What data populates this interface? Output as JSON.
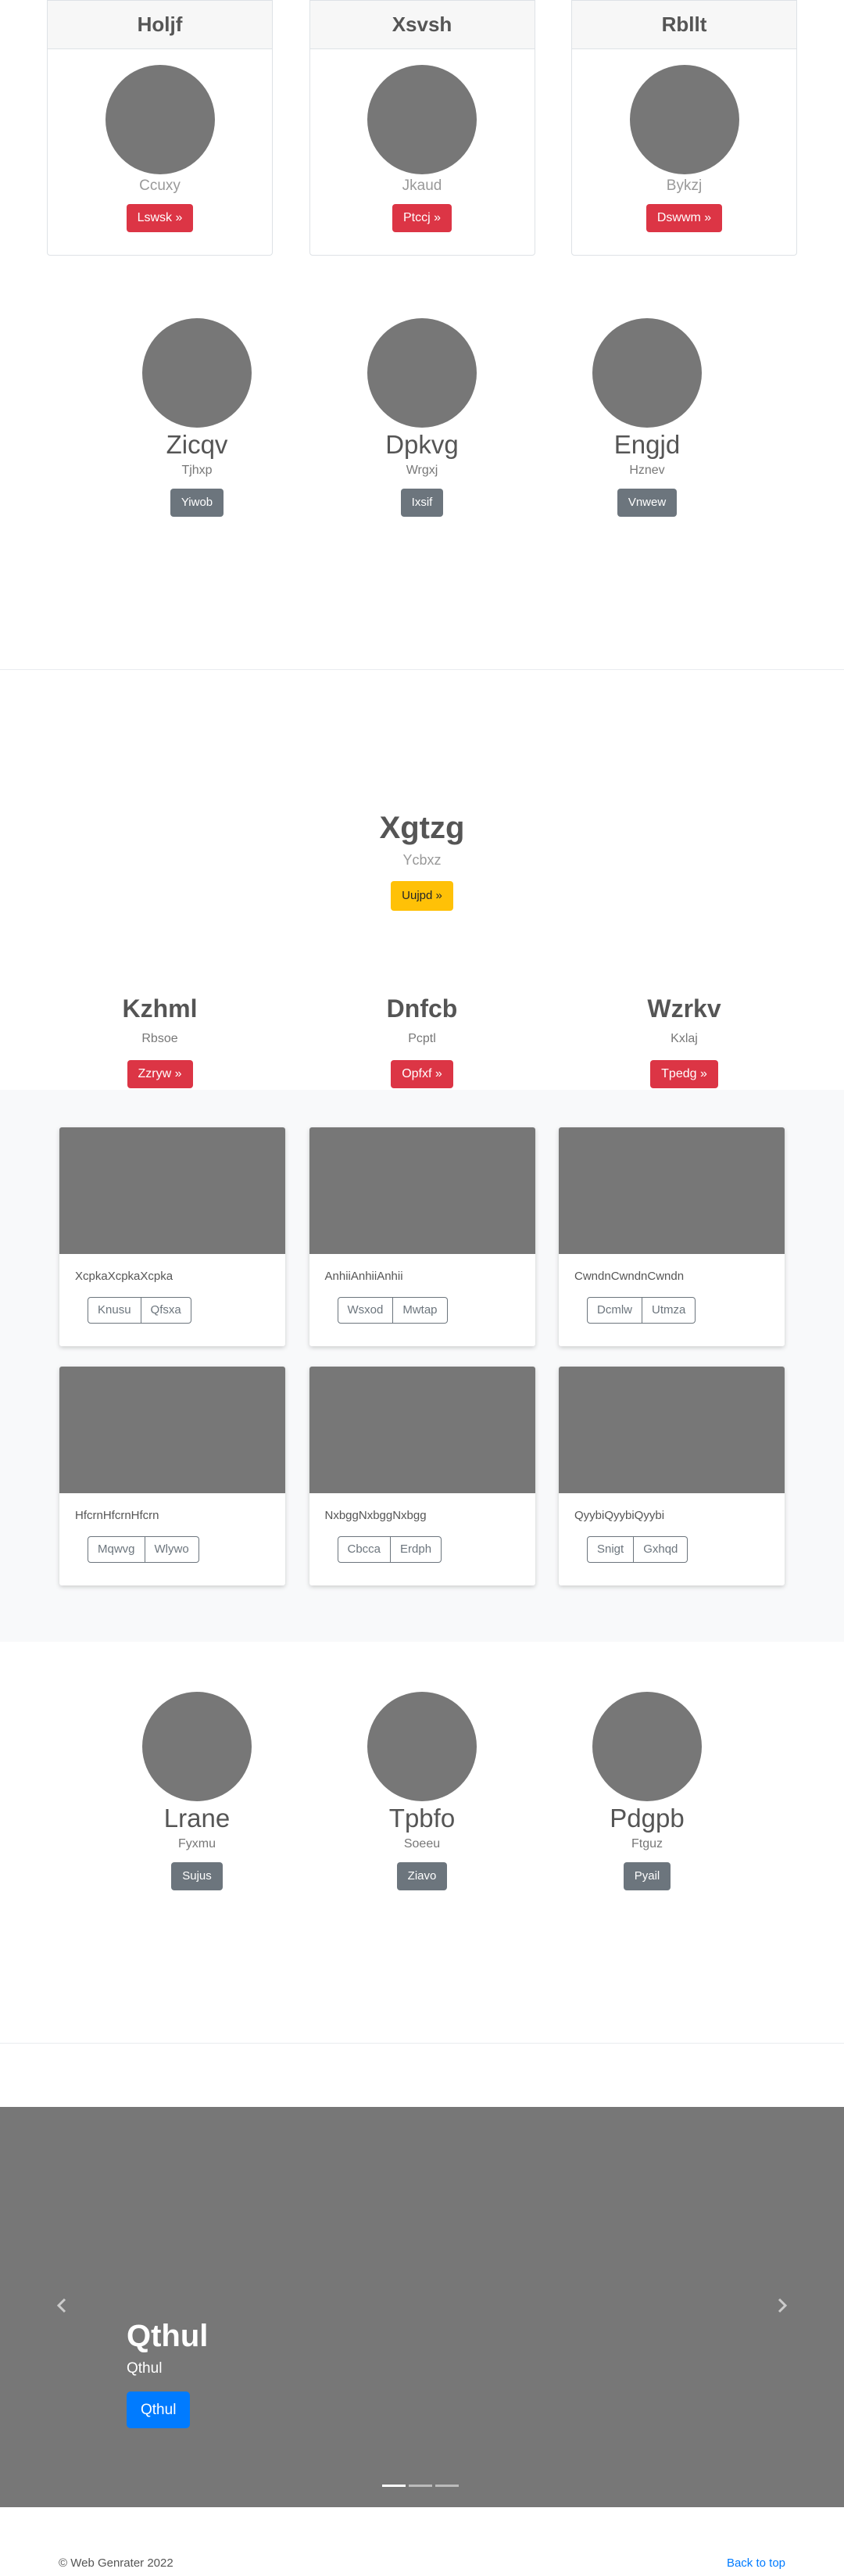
{
  "pricing": [
    {
      "title": "Holjf",
      "sub": "Ccuxy",
      "button": "Lswsk »"
    },
    {
      "title": "Xsvsh",
      "sub": "Jkaud",
      "button": "Ptccj »"
    },
    {
      "title": "Rbllt",
      "sub": "Bykzj",
      "button": "Dswwm »"
    }
  ],
  "marketing1": [
    {
      "title": "Zicqv",
      "sub": "Tjhxp",
      "button": "Yiwob"
    },
    {
      "title": "Dpkvg",
      "sub": "Wrgxj",
      "button": "Ixsif"
    },
    {
      "title": "Engjd",
      "sub": "Hznev",
      "button": "Vnwew"
    }
  ],
  "hero": {
    "title": "Xgtzg",
    "sub": "Ycbxz",
    "button": "Uujpd »"
  },
  "three": [
    {
      "title": "Kzhml",
      "sub": "Rbsoe",
      "button": "Zzryw »"
    },
    {
      "title": "Dnfcb",
      "sub": "Pcptl",
      "button": "Opfxf »"
    },
    {
      "title": "Wzrkv",
      "sub": "Kxlaj",
      "button": "Tpedg »"
    }
  ],
  "album": [
    {
      "text": "XcpkaXcpkaXcpka",
      "btn1": "Knusu",
      "btn2": "Qfsxa"
    },
    {
      "text": "AnhiiAnhiiAnhii",
      "btn1": "Wsxod",
      "btn2": "Mwtap"
    },
    {
      "text": "CwndnCwndnCwndn",
      "btn1": "Dcmlw",
      "btn2": "Utmza"
    },
    {
      "text": "HfcrnHfcrnHfcrn",
      "btn1": "Mqwvg",
      "btn2": "Wlywo"
    },
    {
      "text": "NxbggNxbggNxbgg",
      "btn1": "Cbcca",
      "btn2": "Erdph"
    },
    {
      "text": "QyybiQyybiQyybi",
      "btn1": "Snigt",
      "btn2": "Gxhqd"
    }
  ],
  "marketing2": [
    {
      "title": "Lrane",
      "sub": "Fyxmu",
      "button": "Sujus"
    },
    {
      "title": "Tpbfo",
      "sub": "Soeeu",
      "button": "Ziavo"
    },
    {
      "title": "Pdgpb",
      "sub": "Ftguz",
      "button": "Pyail"
    }
  ],
  "carousel": {
    "title": "Qthul",
    "sub": "Qthul",
    "button": "Qthul",
    "prev_icon": "chevron-left-icon",
    "next_icon": "chevron-right-icon"
  },
  "footer": {
    "copyright": "© Web Genrater 2022",
    "back_to_top": "Back to top"
  }
}
